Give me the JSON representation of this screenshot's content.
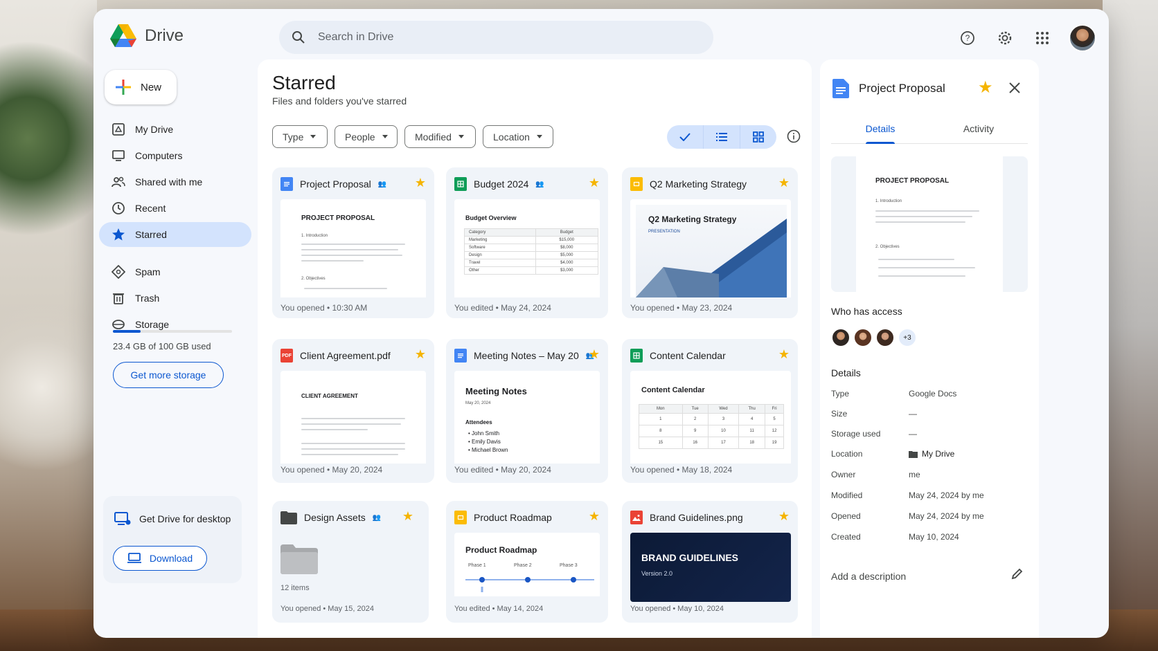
{
  "app": {
    "name": "Drive"
  },
  "search": {
    "placeholder": "Search in Drive"
  },
  "sidebar": {
    "new_label": "New",
    "items": [
      {
        "label": "My Drive"
      },
      {
        "label": "Computers"
      },
      {
        "label": "Shared with me"
      },
      {
        "label": "Recent"
      },
      {
        "label": "Starred",
        "active": true
      },
      {
        "label": "Spam"
      },
      {
        "label": "Trash"
      },
      {
        "label": "Storage"
      }
    ],
    "storage_text": "23.4 GB of 100 GB used",
    "storage_fraction": 0.234,
    "more_storage_label": "Get more storage",
    "desktop_title": "Get Drive for desktop",
    "download_label": "Download"
  },
  "main": {
    "title": "Starred",
    "subtitle": "Files and folders you've starred",
    "filters": [
      "Type",
      "People",
      "Modified",
      "Location"
    ],
    "files": [
      {
        "name": "Project Proposal",
        "meta": "You opened • 10:30 AM",
        "type": "doc",
        "thumb": {
          "heading": "PROJECT PROPOSAL",
          "sub1": "1. Introduction",
          "sub2": "2. Objectives"
        }
      },
      {
        "name": "Budget 2024",
        "meta": "You edited • May 24, 2024",
        "type": "sheet",
        "thumb": {
          "heading": "Budget Overview",
          "cols": [
            "Category",
            "Budget"
          ],
          "rows": [
            [
              "Marketing",
              "$15,000"
            ],
            [
              "Software",
              "$8,000"
            ],
            [
              "Design",
              "$5,000"
            ],
            [
              "Travel",
              "$4,000"
            ],
            [
              "Other",
              "$3,000"
            ]
          ]
        }
      },
      {
        "name": "Q2 Marketing Strategy",
        "meta": "You opened • May 23, 2024",
        "type": "slide",
        "thumb": {
          "heading": "Q2 Marketing Strategy",
          "sub1": "PRESENTATION"
        }
      },
      {
        "name": "Client Agreement.pdf",
        "meta": "You opened • May 20, 2024",
        "type": "pdf",
        "thumb": {
          "heading": "CLIENT AGREEMENT"
        }
      },
      {
        "name": "Meeting Notes – May 20",
        "meta": "You edited • May 20, 2024",
        "type": "doc",
        "thumb": {
          "heading": "Meeting Notes",
          "date": "May 20, 2024",
          "attendees_label": "Attendees",
          "attendees": [
            "John Smith",
            "Emily Davis",
            "Michael Brown"
          ]
        }
      },
      {
        "name": "Content Calendar",
        "meta": "You opened • May 18, 2024",
        "type": "sheet",
        "thumb": {
          "heading": "Content Calendar",
          "days": [
            "Mon",
            "Tue",
            "Wed",
            "Thu",
            "Fri"
          ],
          "weeks": [
            [
              "1",
              "2",
              "3",
              "4",
              "5"
            ],
            [
              "8",
              "9",
              "10",
              "11",
              "12"
            ],
            [
              "15",
              "16",
              "17",
              "18",
              "19"
            ]
          ]
        }
      },
      {
        "name": "Design Assets",
        "meta": "You opened • May 15, 2024",
        "type": "folder",
        "thumb": {
          "items": "12 items"
        }
      },
      {
        "name": "Product Roadmap",
        "meta": "You edited • May 14, 2024",
        "type": "slide",
        "thumb": {
          "heading": "Product Roadmap",
          "phases": [
            "Phase 1",
            "Phase 2",
            "Phase 3"
          ]
        }
      },
      {
        "name": "Brand Guidelines.png",
        "meta": "You opened • May 10, 2024",
        "type": "image",
        "thumb": {
          "heading": "BRAND GUIDELINES",
          "sub1": "Version 2.0"
        }
      }
    ]
  },
  "panel": {
    "title": "Project Proposal",
    "tabs": [
      "Details",
      "Activity"
    ],
    "thumb": {
      "heading": "PROJECT PROPOSAL",
      "sub1": "1. Introduction",
      "sub2": "2. Objectives"
    },
    "access_title": "Who has access",
    "access_more": "+3",
    "details_title": "Details",
    "details": [
      {
        "k": "Type",
        "v": "Google Docs"
      },
      {
        "k": "Size",
        "v": "—"
      },
      {
        "k": "Storage used",
        "v": "—"
      },
      {
        "k": "Location",
        "v": "My Drive"
      },
      {
        "k": "Owner",
        "v": "me"
      },
      {
        "k": "Modified",
        "v": "May 24, 2024 by me"
      },
      {
        "k": "Opened",
        "v": "May 24, 2024 by me"
      },
      {
        "k": "Created",
        "v": "May 10, 2024"
      }
    ],
    "add_description": "Add a description"
  },
  "colors": {
    "accent": "#0b57d0",
    "star": "#f5b400",
    "active_nav": "#d3e3fd"
  }
}
